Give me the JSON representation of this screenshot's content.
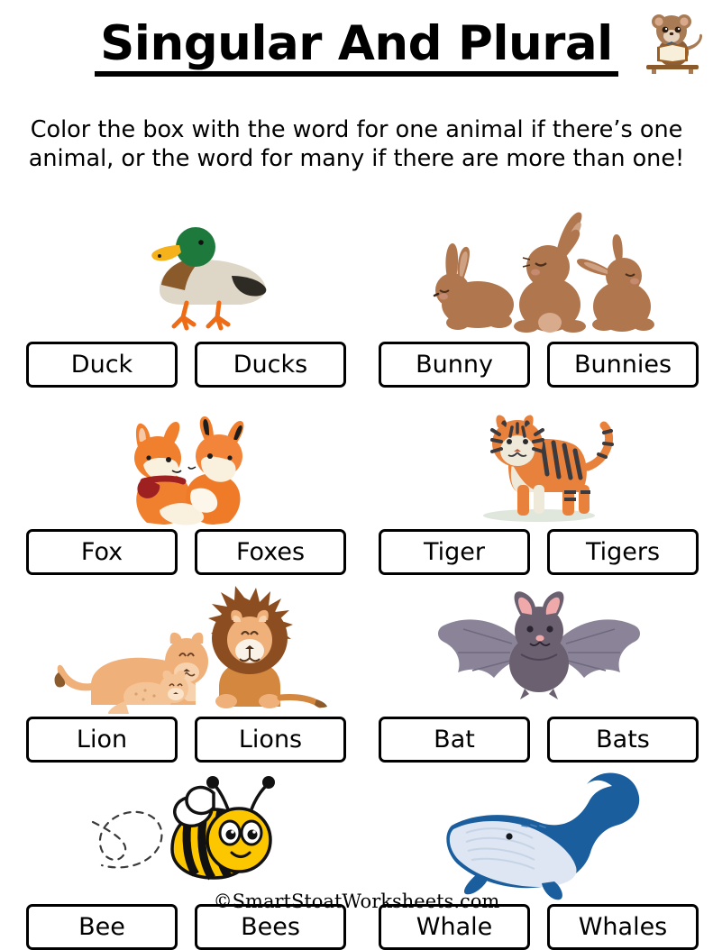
{
  "header": {
    "title": "Singular And Plural",
    "instructions": "Color the box with the word for one animal if there’s one animal, or the word for many if there are more than one!",
    "logo_icon": "stoat-reading-book-logo"
  },
  "items": [
    {
      "art_icon": "duck-illustration",
      "art_alt": "one mallard duck walking",
      "count": 1,
      "singular": "Duck",
      "plural": "Ducks",
      "correct": "Duck"
    },
    {
      "art_icon": "bunnies-illustration",
      "art_alt": "three brown bunnies",
      "count": 3,
      "singular": "Bunny",
      "plural": "Bunnies",
      "correct": "Bunnies"
    },
    {
      "art_icon": "foxes-illustration",
      "art_alt": "two orange foxes cuddling, one wearing a red scarf",
      "count": 2,
      "singular": "Fox",
      "plural": "Foxes",
      "correct": "Foxes"
    },
    {
      "art_icon": "tiger-illustration",
      "art_alt": "one standing tiger",
      "count": 1,
      "singular": "Tiger",
      "plural": "Tigers",
      "correct": "Tiger"
    },
    {
      "art_icon": "lions-illustration",
      "art_alt": "a lion, lioness and cub",
      "count": 3,
      "singular": "Lion",
      "plural": "Lions",
      "correct": "Lions"
    },
    {
      "art_icon": "bat-illustration",
      "art_alt": "one bat with spread wings",
      "count": 1,
      "singular": "Bat",
      "plural": "Bats",
      "correct": "Bat"
    },
    {
      "art_icon": "bee-illustration",
      "art_alt": "one bee with dashed flight trail",
      "count": 1,
      "singular": "Bee",
      "plural": "Bees",
      "correct": "Bee"
    },
    {
      "art_icon": "whale-illustration",
      "art_alt": "one blue whale",
      "count": 1,
      "singular": "Whale",
      "plural": "Whales",
      "correct": "Whale"
    }
  ],
  "footer": {
    "credit": "©SmartStoatWorksheets.com"
  },
  "colors": {
    "ink": "#000000",
    "paper": "#ffffff",
    "duck_head": "#1e7a3c",
    "duck_bill": "#f5b21a",
    "duck_body": "#ded7c8",
    "duck_breast": "#8a5a2b",
    "duck_feet": "#ef6c16",
    "bunny": "#b0774f",
    "bunny_shade": "#9c6542",
    "fox": "#f07f2e",
    "fox_light": "#faf0de",
    "fox_scarf": "#9e2020",
    "tiger": "#e8813c",
    "tiger_stripe": "#3a3a3f",
    "tiger_belly": "#efe9d9",
    "lion": "#f0b07a",
    "lion_mane": "#8c4e20",
    "bat_body": "#6b6070",
    "bat_wing": "#8b8498",
    "bat_ear": "#f0a9ab",
    "bee_yellow": "#fdc700",
    "whale": "#1b5e9e",
    "whale_belly": "#dde6f2"
  }
}
